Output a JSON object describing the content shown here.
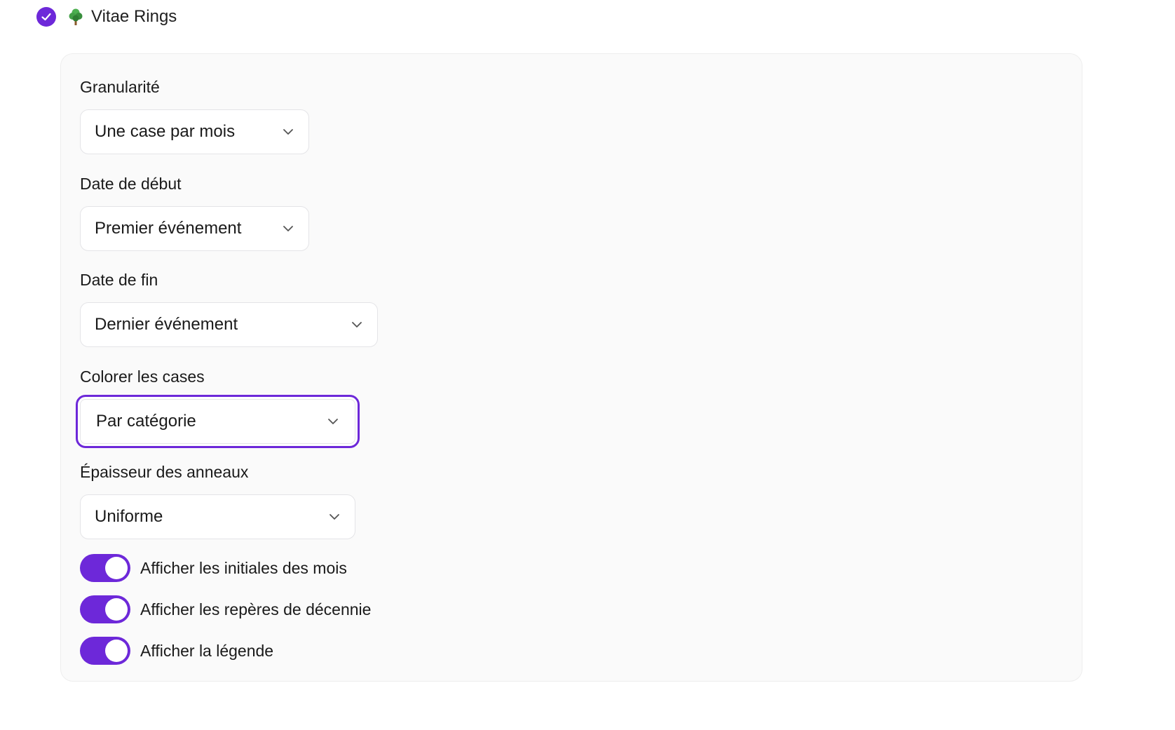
{
  "header": {
    "title": "Vitae Rings",
    "icon": "tree-icon"
  },
  "colors": {
    "accent": "#6d28d9",
    "panel_bg": "#fafafa"
  },
  "fields": [
    {
      "label": "Granularité",
      "value": "Une case par mois"
    },
    {
      "label": "Date de début",
      "value": "Premier événement"
    },
    {
      "label": "Date de fin",
      "value": "Dernier événement"
    },
    {
      "label": "Colorer les cases",
      "value": "Par catégorie"
    },
    {
      "label": "Épaisseur des anneaux",
      "value": "Uniforme"
    }
  ],
  "toggles": [
    {
      "label": "Afficher les initiales des mois",
      "enabled": true
    },
    {
      "label": "Afficher les repères de décennie",
      "enabled": true
    },
    {
      "label": "Afficher la légende",
      "enabled": true
    }
  ]
}
